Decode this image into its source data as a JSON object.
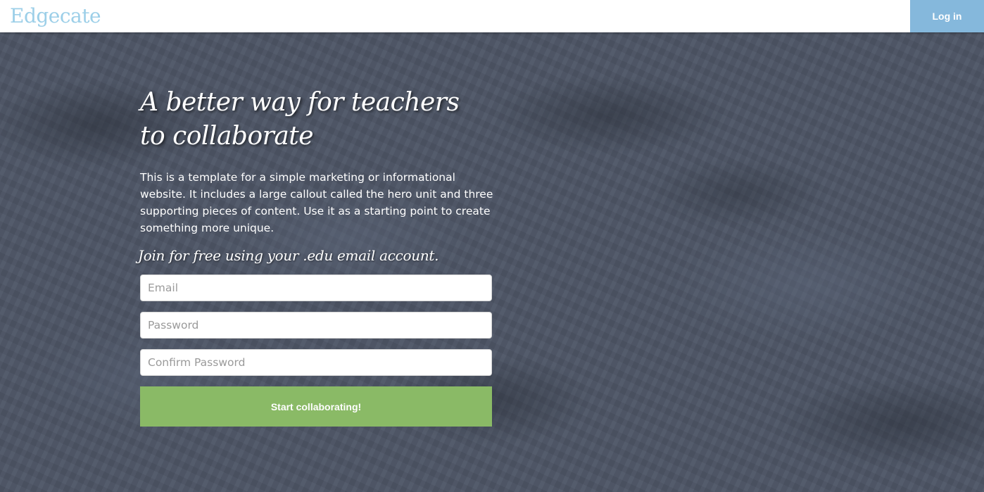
{
  "navbar": {
    "brand": "Edgecate",
    "login_label": "Log in"
  },
  "hero": {
    "headline_line1": "A better way for teachers",
    "headline_line2": "to collaborate",
    "lead": "This is a template for a simple marketing or informational website. It includes a large callout called the hero unit and three supporting pieces of content. Use it as a starting point to create something more unique.",
    "join_text": "Join for free using your .edu email account."
  },
  "form": {
    "email_placeholder": "Email",
    "password_placeholder": "Password",
    "confirm_password_placeholder": "Confirm Password",
    "submit_label": "Start collaborating!"
  },
  "colors": {
    "brand": "#9ccfe8",
    "login_button": "#85b8dc",
    "submit_button": "#8aba66",
    "hero_background": "#4d5565"
  }
}
